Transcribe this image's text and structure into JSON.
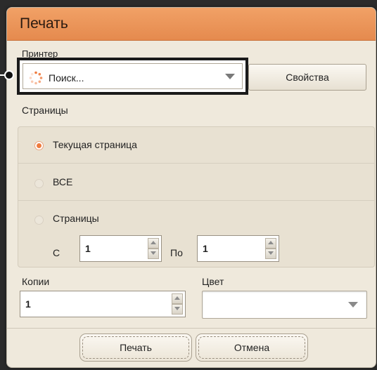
{
  "dialog": {
    "title": "Печать"
  },
  "printer": {
    "label": "Принтер",
    "selected": "Поиск...",
    "properties_button": "Свойства"
  },
  "pages": {
    "label": "Страницы",
    "options": [
      {
        "label": "Текущая страница",
        "selected": true
      },
      {
        "label": "ВСЕ",
        "selected": false
      },
      {
        "label": "Страницы",
        "selected": false
      }
    ],
    "from_label": "С",
    "from_value": "1",
    "to_label": "По",
    "to_value": "1"
  },
  "copies": {
    "label": "Копии",
    "value": "1"
  },
  "color": {
    "label": "Цвет",
    "selected": ""
  },
  "buttons": {
    "print": "Печать",
    "cancel": "Отмена"
  },
  "colors": {
    "titlebar": "#e58a4e",
    "radio_selected": "#ef7b3e",
    "dialog_bg": "#efe9dc"
  }
}
